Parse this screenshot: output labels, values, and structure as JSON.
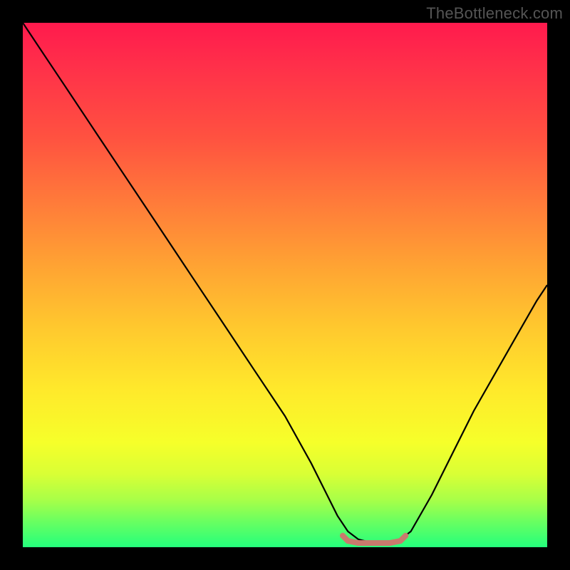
{
  "watermark": {
    "text": "TheBottleneck.com"
  },
  "chart_data": {
    "type": "line",
    "title": "",
    "xlabel": "",
    "ylabel": "",
    "xlim": [
      0,
      100
    ],
    "ylim": [
      0,
      100
    ],
    "grid": false,
    "legend": false,
    "series": [
      {
        "name": "curve",
        "color": "#000000",
        "x": [
          0,
          4,
          8,
          14,
          20,
          26,
          32,
          38,
          44,
          50,
          55,
          58,
          60,
          62,
          64,
          66,
          68,
          70,
          72,
          74,
          78,
          82,
          86,
          90,
          94,
          98,
          100
        ],
        "y": [
          100,
          94,
          88,
          79,
          70,
          61,
          52,
          43,
          34,
          25,
          16,
          10,
          6,
          3,
          1.5,
          1,
          1,
          1,
          1.5,
          3,
          10,
          18,
          26,
          33,
          40,
          47,
          50
        ]
      },
      {
        "name": "base-marker",
        "color": "#c97a6d",
        "x": [
          61,
          62,
          64,
          66,
          68,
          70,
          72,
          73
        ],
        "y": [
          2.2,
          1.2,
          0.8,
          0.8,
          0.8,
          0.8,
          1.2,
          2.2
        ]
      }
    ],
    "background_gradient": {
      "orientation": "vertical",
      "stops": [
        {
          "pos": 0,
          "color": "#ff1a4d"
        },
        {
          "pos": 22,
          "color": "#ff5240"
        },
        {
          "pos": 46,
          "color": "#ffa233"
        },
        {
          "pos": 70,
          "color": "#ffe92b"
        },
        {
          "pos": 91,
          "color": "#a8ff48"
        },
        {
          "pos": 100,
          "color": "#24ff7c"
        }
      ]
    }
  }
}
